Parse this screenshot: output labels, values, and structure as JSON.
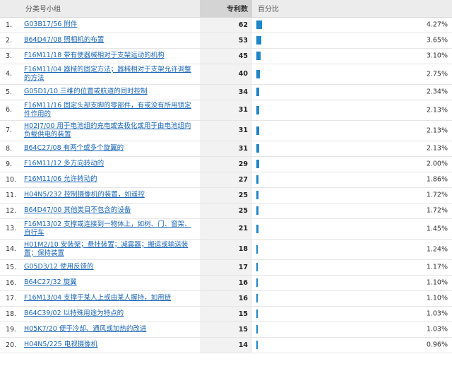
{
  "header": {
    "group": "分类号小组",
    "count": "专利数",
    "percent": "百分比"
  },
  "accent": "#1f86c8",
  "rows": [
    {
      "idx": "1.",
      "group": "G03B17/56 附件",
      "count": 62,
      "percent": "4.27%",
      "share": 4.27
    },
    {
      "idx": "2.",
      "group": "B64D47/08 照相机的布置",
      "count": 53,
      "percent": "3.65%",
      "share": 3.65
    },
    {
      "idx": "3.",
      "group": "F16M11/18 带有使器械相对于支架运动的机构",
      "count": 45,
      "percent": "3.10%",
      "share": 3.1
    },
    {
      "idx": "4.",
      "group": "F16M11/04 器械的固定方法；器械相对于支架允许调整的方法",
      "count": 40,
      "percent": "2.75%",
      "share": 2.75
    },
    {
      "idx": "5.",
      "group": "G05D1/10 三维的位置或航道的同时控制",
      "count": 34,
      "percent": "2.34%",
      "share": 2.34
    },
    {
      "idx": "6.",
      "group": "F16M11/16 固定头部支脚的零部件，有或没有所用锁定件作用的",
      "count": 31,
      "percent": "2.13%",
      "share": 2.13
    },
    {
      "idx": "7.",
      "group": "H02J7/00 用于电池组的充电或去极化或用于由电池组向负载供电的装置",
      "count": 31,
      "percent": "2.13%",
      "share": 2.13
    },
    {
      "idx": "8.",
      "group": "B64C27/08 有两个或多个旋翼的",
      "count": 31,
      "percent": "2.13%",
      "share": 2.13
    },
    {
      "idx": "9.",
      "group": "F16M11/12 多方向转动的",
      "count": 29,
      "percent": "2.00%",
      "share": 2.0
    },
    {
      "idx": "10.",
      "group": "F16M11/06 允许转动的",
      "count": 27,
      "percent": "1.86%",
      "share": 1.86
    },
    {
      "idx": "11.",
      "group": "H04N5/232 控制摄像机的装置，如遥控",
      "count": 25,
      "percent": "1.72%",
      "share": 1.72
    },
    {
      "idx": "12.",
      "group": "B64D47/00 其他类目不包含的设备",
      "count": 25,
      "percent": "1.72%",
      "share": 1.72
    },
    {
      "idx": "13.",
      "group": "F16M13/02 支撑或连接到一物体上，如树、门、窗架、自行车",
      "count": 21,
      "percent": "1.45%",
      "share": 1.45
    },
    {
      "idx": "14.",
      "group": "H01M2/10 安装架；悬挂装置；减震器；搬运或输送装置；保持装置",
      "count": 18,
      "percent": "1.24%",
      "share": 1.24
    },
    {
      "idx": "15.",
      "group": "G05D3/12 使用反馈的",
      "count": 17,
      "percent": "1.17%",
      "share": 1.17
    },
    {
      "idx": "16.",
      "group": "B64C27/32 旋翼",
      "count": 16,
      "percent": "1.10%",
      "share": 1.1
    },
    {
      "idx": "17.",
      "group": "F16M13/04 支撑于某人上或由某人握持，如用链",
      "count": 16,
      "percent": "1.10%",
      "share": 1.1
    },
    {
      "idx": "18.",
      "group": "B64C39/02 以特殊用途为特点的",
      "count": 15,
      "percent": "1.03%",
      "share": 1.03
    },
    {
      "idx": "19.",
      "group": "H05K7/20 便于冷却、通风或加热的改进",
      "count": 15,
      "percent": "1.03%",
      "share": 1.03
    },
    {
      "idx": "20.",
      "group": "H04N5/225 电视摄像机",
      "count": 14,
      "percent": "0.96%",
      "share": 0.96
    }
  ]
}
